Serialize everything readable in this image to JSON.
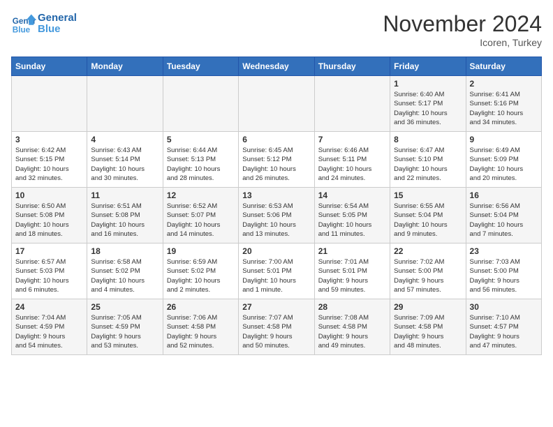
{
  "logo": {
    "line1": "General",
    "line2": "Blue"
  },
  "title": "November 2024",
  "location": "Icoren, Turkey",
  "weekdays": [
    "Sunday",
    "Monday",
    "Tuesday",
    "Wednesday",
    "Thursday",
    "Friday",
    "Saturday"
  ],
  "weeks": [
    [
      {
        "day": "",
        "info": ""
      },
      {
        "day": "",
        "info": ""
      },
      {
        "day": "",
        "info": ""
      },
      {
        "day": "",
        "info": ""
      },
      {
        "day": "",
        "info": ""
      },
      {
        "day": "1",
        "info": "Sunrise: 6:40 AM\nSunset: 5:17 PM\nDaylight: 10 hours\nand 36 minutes."
      },
      {
        "day": "2",
        "info": "Sunrise: 6:41 AM\nSunset: 5:16 PM\nDaylight: 10 hours\nand 34 minutes."
      }
    ],
    [
      {
        "day": "3",
        "info": "Sunrise: 6:42 AM\nSunset: 5:15 PM\nDaylight: 10 hours\nand 32 minutes."
      },
      {
        "day": "4",
        "info": "Sunrise: 6:43 AM\nSunset: 5:14 PM\nDaylight: 10 hours\nand 30 minutes."
      },
      {
        "day": "5",
        "info": "Sunrise: 6:44 AM\nSunset: 5:13 PM\nDaylight: 10 hours\nand 28 minutes."
      },
      {
        "day": "6",
        "info": "Sunrise: 6:45 AM\nSunset: 5:12 PM\nDaylight: 10 hours\nand 26 minutes."
      },
      {
        "day": "7",
        "info": "Sunrise: 6:46 AM\nSunset: 5:11 PM\nDaylight: 10 hours\nand 24 minutes."
      },
      {
        "day": "8",
        "info": "Sunrise: 6:47 AM\nSunset: 5:10 PM\nDaylight: 10 hours\nand 22 minutes."
      },
      {
        "day": "9",
        "info": "Sunrise: 6:49 AM\nSunset: 5:09 PM\nDaylight: 10 hours\nand 20 minutes."
      }
    ],
    [
      {
        "day": "10",
        "info": "Sunrise: 6:50 AM\nSunset: 5:08 PM\nDaylight: 10 hours\nand 18 minutes."
      },
      {
        "day": "11",
        "info": "Sunrise: 6:51 AM\nSunset: 5:08 PM\nDaylight: 10 hours\nand 16 minutes."
      },
      {
        "day": "12",
        "info": "Sunrise: 6:52 AM\nSunset: 5:07 PM\nDaylight: 10 hours\nand 14 minutes."
      },
      {
        "day": "13",
        "info": "Sunrise: 6:53 AM\nSunset: 5:06 PM\nDaylight: 10 hours\nand 13 minutes."
      },
      {
        "day": "14",
        "info": "Sunrise: 6:54 AM\nSunset: 5:05 PM\nDaylight: 10 hours\nand 11 minutes."
      },
      {
        "day": "15",
        "info": "Sunrise: 6:55 AM\nSunset: 5:04 PM\nDaylight: 10 hours\nand 9 minutes."
      },
      {
        "day": "16",
        "info": "Sunrise: 6:56 AM\nSunset: 5:04 PM\nDaylight: 10 hours\nand 7 minutes."
      }
    ],
    [
      {
        "day": "17",
        "info": "Sunrise: 6:57 AM\nSunset: 5:03 PM\nDaylight: 10 hours\nand 6 minutes."
      },
      {
        "day": "18",
        "info": "Sunrise: 6:58 AM\nSunset: 5:02 PM\nDaylight: 10 hours\nand 4 minutes."
      },
      {
        "day": "19",
        "info": "Sunrise: 6:59 AM\nSunset: 5:02 PM\nDaylight: 10 hours\nand 2 minutes."
      },
      {
        "day": "20",
        "info": "Sunrise: 7:00 AM\nSunset: 5:01 PM\nDaylight: 10 hours\nand 1 minute."
      },
      {
        "day": "21",
        "info": "Sunrise: 7:01 AM\nSunset: 5:01 PM\nDaylight: 9 hours\nand 59 minutes."
      },
      {
        "day": "22",
        "info": "Sunrise: 7:02 AM\nSunset: 5:00 PM\nDaylight: 9 hours\nand 57 minutes."
      },
      {
        "day": "23",
        "info": "Sunrise: 7:03 AM\nSunset: 5:00 PM\nDaylight: 9 hours\nand 56 minutes."
      }
    ],
    [
      {
        "day": "24",
        "info": "Sunrise: 7:04 AM\nSunset: 4:59 PM\nDaylight: 9 hours\nand 54 minutes."
      },
      {
        "day": "25",
        "info": "Sunrise: 7:05 AM\nSunset: 4:59 PM\nDaylight: 9 hours\nand 53 minutes."
      },
      {
        "day": "26",
        "info": "Sunrise: 7:06 AM\nSunset: 4:58 PM\nDaylight: 9 hours\nand 52 minutes."
      },
      {
        "day": "27",
        "info": "Sunrise: 7:07 AM\nSunset: 4:58 PM\nDaylight: 9 hours\nand 50 minutes."
      },
      {
        "day": "28",
        "info": "Sunrise: 7:08 AM\nSunset: 4:58 PM\nDaylight: 9 hours\nand 49 minutes."
      },
      {
        "day": "29",
        "info": "Sunrise: 7:09 AM\nSunset: 4:58 PM\nDaylight: 9 hours\nand 48 minutes."
      },
      {
        "day": "30",
        "info": "Sunrise: 7:10 AM\nSunset: 4:57 PM\nDaylight: 9 hours\nand 47 minutes."
      }
    ]
  ]
}
